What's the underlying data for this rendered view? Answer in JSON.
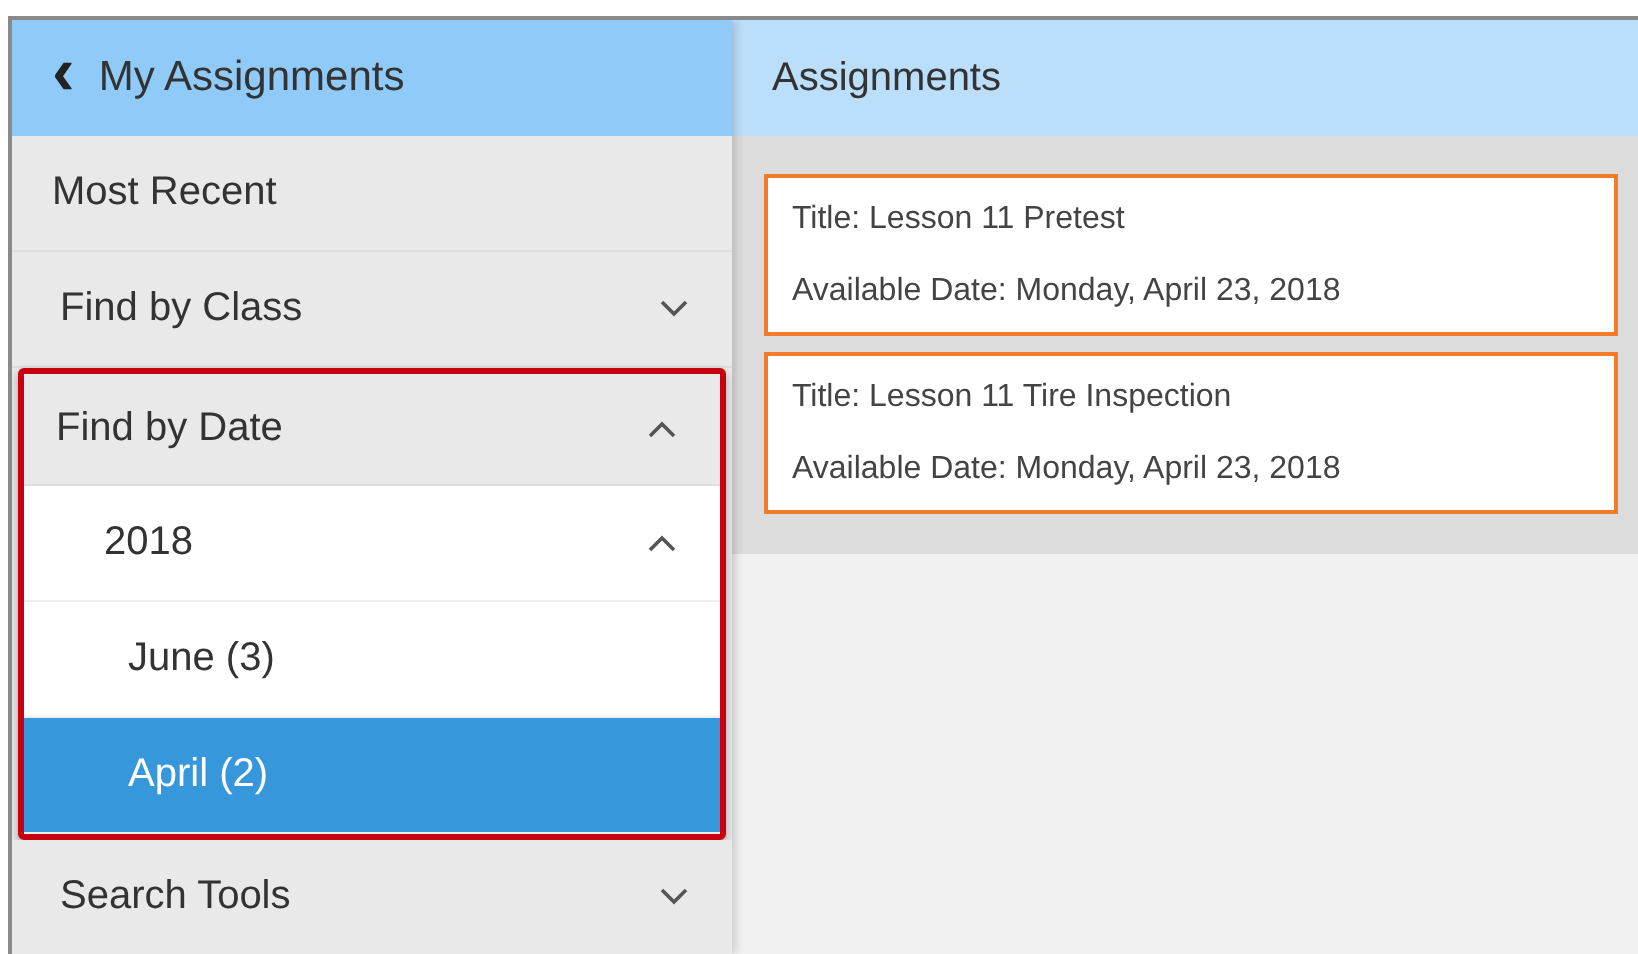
{
  "sidebar": {
    "back_icon": "‹",
    "title": "My Assignments",
    "items": [
      {
        "kind": "link",
        "label": "Most Recent",
        "selected": false
      },
      {
        "kind": "section",
        "label": "Find by Class",
        "expanded": false,
        "highlighted": false
      },
      {
        "kind": "section",
        "label": "Find by Date",
        "expanded": true,
        "highlighted": true,
        "children": [
          {
            "kind": "section",
            "label": "2018",
            "expanded": true,
            "highlighted": false,
            "children": [
              {
                "kind": "link",
                "label": "June (3)",
                "selected": false
              },
              {
                "kind": "link",
                "label": "April (2)",
                "selected": true
              }
            ]
          }
        ]
      },
      {
        "kind": "section",
        "label": "Search Tools",
        "expanded": false,
        "highlighted": false
      }
    ]
  },
  "main": {
    "title": "Assignments",
    "cards": [
      {
        "title": "Title: Lesson 11 Pretest",
        "date": "Available Date: Monday, April 23, 2018"
      },
      {
        "title": "Title: Lesson 11 Tire Inspection",
        "date": "Available Date: Monday, April 23, 2018"
      }
    ]
  }
}
